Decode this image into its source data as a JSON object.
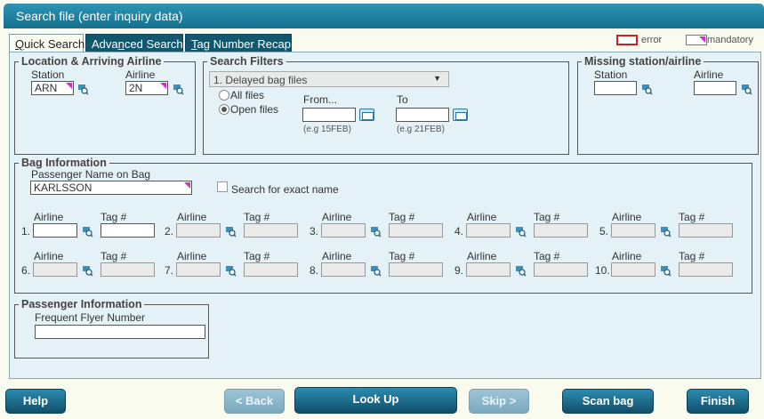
{
  "window": {
    "title": "Search file (enter inquiry data)"
  },
  "tabs": [
    {
      "label": "Quick Search",
      "key": "Q"
    },
    {
      "label": "Advanced Search",
      "key": "n"
    },
    {
      "label": "Tag Number Recap",
      "key": "T"
    }
  ],
  "legend": {
    "error": "error",
    "mandatory": "mandatory",
    "error_color": "#cc2222",
    "mandatory_color": "#d030c8"
  },
  "location": {
    "legend": "Location & Arriving Airline",
    "station_label": "Station",
    "station_value": "ARN",
    "airline_label": "Airline",
    "airline_value": "2N"
  },
  "filters": {
    "legend": "Search Filters",
    "file_type": "1. Delayed bag files",
    "all_files": "All files",
    "open_files": "Open files",
    "from_label": "From...",
    "to_label": "To",
    "from_hint": "(e.g 15FEB)",
    "to_hint": "(e.g 21FEB)"
  },
  "missing": {
    "legend": "Missing station/airline",
    "station_label": "Station",
    "airline_label": "Airline"
  },
  "bag": {
    "legend": "Bag Information",
    "pax_name_label": "Passenger Name on Bag",
    "pax_name_value": "KARLSSON",
    "exact_name": "Search for exact name",
    "airline_label": "Airline",
    "tag_label": "Tag #",
    "rows": [
      [
        "1.",
        "2.",
        "3.",
        "4.",
        "5."
      ],
      [
        "6.",
        "7.",
        "8.",
        "9.",
        "10."
      ]
    ]
  },
  "passenger": {
    "legend": "Passenger Information",
    "ff_label": "Frequent Flyer Number"
  },
  "buttons": {
    "help": "Help",
    "back": "< Back",
    "lookup": "Look Up",
    "skip": "Skip >",
    "scan": "Scan bag",
    "finish": "Finish"
  },
  "colors": {
    "accent": "#13718f",
    "tab_dark": "#13576f",
    "panel": "#e4f1f7"
  }
}
